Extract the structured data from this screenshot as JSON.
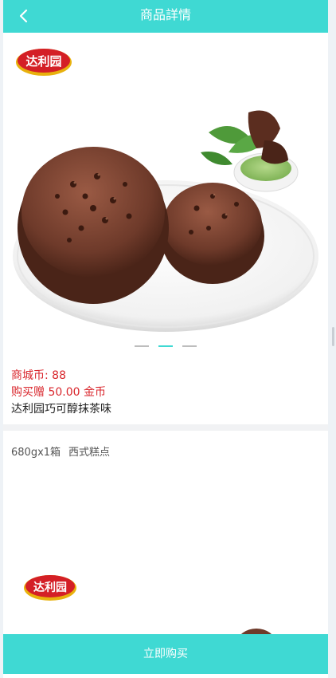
{
  "header": {
    "title": "商品詳情",
    "back_icon": "chevron-left-icon"
  },
  "carousel": {
    "slide_count": 3,
    "active_index": 1,
    "brand_logo_text": "达利园"
  },
  "product": {
    "coins_label": "商城币: 88",
    "bonus_label": "购买赠 50.00 金币",
    "name": "达利园巧可醇抹茶味",
    "spec_weight": "680gx1箱",
    "spec_category": "西式糕点"
  },
  "detail": {
    "brand_logo_text": "达利园"
  },
  "footer": {
    "buy_label": "立即购买"
  },
  "colors": {
    "accent": "#3fd9d3",
    "price_red": "#d9262c"
  }
}
